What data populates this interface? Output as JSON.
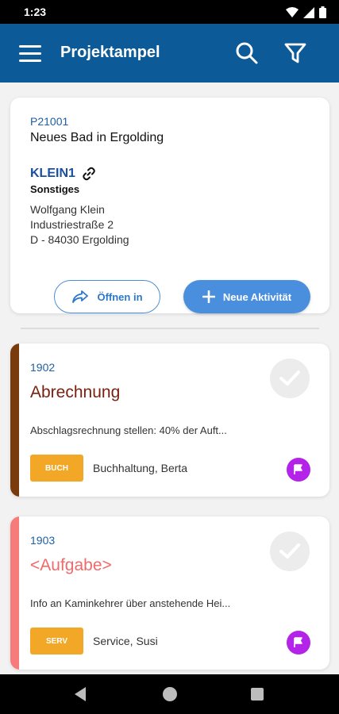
{
  "status": {
    "time": "1:23"
  },
  "appbar": {
    "title": "Projektampel",
    "menu_icon": "menu-icon",
    "search_icon": "search-icon",
    "filter_icon": "filter-icon"
  },
  "project": {
    "number": "P21001",
    "name": "Neues Bad in Ergolding",
    "code": "KLEIN1",
    "category": "Sonstiges",
    "address_name": "Wolfgang Klein",
    "address_street": "Industriestraße 2",
    "address_city": "D - 84030 Ergolding",
    "open_label": "Öffnen in",
    "new_activity_label": "Neue Aktivität"
  },
  "tasks": [
    {
      "number": "1902",
      "title": "Abrechnung",
      "title_color": "#7a1f0e",
      "stripe_color": "#7a3b0c",
      "description": "Abschlagsrechnung stellen:  40% der Auft...",
      "badge": "BUCH",
      "person": "Buchhaltung, Berta"
    },
    {
      "number": "1903",
      "title": "<Aufgabe>",
      "title_color": "#f06a6a",
      "stripe_color": "#f77b7b",
      "description": "Info an Kaminkehrer über anstehende Hei...",
      "badge": "SERV",
      "person": "Service, Susi"
    }
  ]
}
